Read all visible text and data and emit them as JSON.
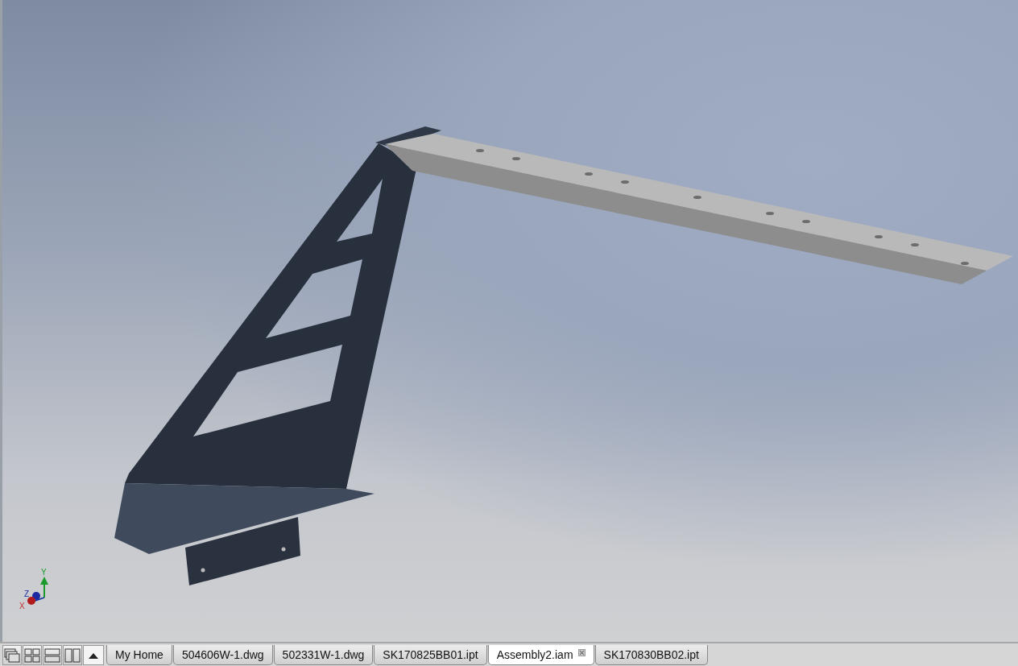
{
  "viewport": {
    "axis_labels": [
      "X",
      "Y",
      "Z"
    ]
  },
  "tab_bar": {
    "tabs": [
      {
        "label": "My Home",
        "selected": false
      },
      {
        "label": "504606W-1.dwg",
        "selected": false
      },
      {
        "label": "502331W-1.dwg",
        "selected": false
      },
      {
        "label": "SK170825BB01.ipt",
        "selected": false
      },
      {
        "label": "Assembly2.iam",
        "selected": true
      },
      {
        "label": "SK170830BB02.ipt",
        "selected": false
      }
    ]
  }
}
